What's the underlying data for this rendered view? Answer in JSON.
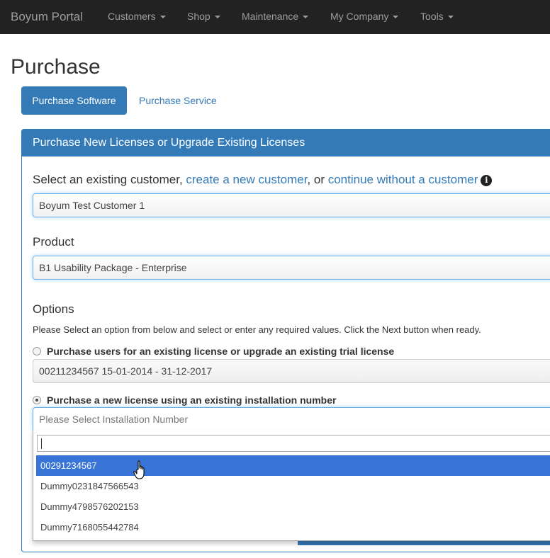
{
  "navbar": {
    "brand": "Boyum Portal",
    "items": [
      {
        "label": "Customers"
      },
      {
        "label": "Shop"
      },
      {
        "label": "Maintenance"
      },
      {
        "label": "My Company"
      },
      {
        "label": "Tools"
      }
    ]
  },
  "page": {
    "title": "Purchase"
  },
  "tabs": {
    "purchase_software": "Purchase Software",
    "purchase_service": "Purchase Service"
  },
  "panel": {
    "heading": "Purchase New Licenses or Upgrade Existing Licenses"
  },
  "customer": {
    "prompt_prefix": "Select an existing customer, ",
    "create_link": "create a new customer",
    "middle": ", or ",
    "continue_link": "continue without a customer",
    "selected": "Boyum Test Customer 1",
    "info_icon": "info-circle-icon"
  },
  "product": {
    "label": "Product",
    "selected": "B1 Usability Package - Enterprise"
  },
  "options": {
    "label": "Options",
    "help": "Please Select an option from below and select or enter any required values. Click the Next button when ready.",
    "option1": {
      "label": "Purchase users for an existing license or upgrade an existing trial license",
      "checked": false,
      "selected": "00211234567 15-01-2014 - 31-12-2017"
    },
    "option2": {
      "label": "Purchase a new license using an existing installation number",
      "checked": true,
      "placeholder": "Please Select Installation Number"
    }
  },
  "installation_dropdown": {
    "search_value": "",
    "options": [
      {
        "label": "00291234567",
        "highlighted": true
      },
      {
        "label": "Dummy0231847566543",
        "highlighted": false
      },
      {
        "label": "Dummy4798576202153",
        "highlighted": false
      },
      {
        "label": "Dummy7168055442784",
        "highlighted": false
      }
    ]
  },
  "colors": {
    "navbar_bg": "#222222",
    "primary": "#337ab7",
    "highlight": "#3875d7"
  }
}
